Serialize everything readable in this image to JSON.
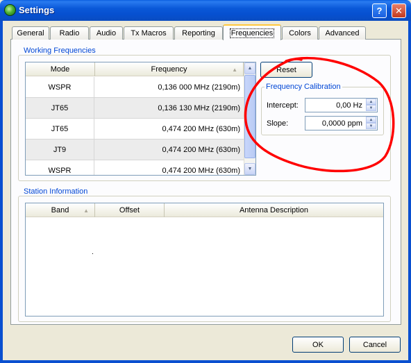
{
  "window": {
    "title": "Settings",
    "help_label": "?",
    "close_label": "✕"
  },
  "tabs": [
    {
      "label": "General"
    },
    {
      "label": "Radio"
    },
    {
      "label": "Audio"
    },
    {
      "label": "Tx Macros"
    },
    {
      "label": "Reporting"
    },
    {
      "label": "Frequencies"
    },
    {
      "label": "Colors"
    },
    {
      "label": "Advanced"
    }
  ],
  "working_frequencies": {
    "title": "Working Frequencies",
    "columns": {
      "mode": "Mode",
      "frequency": "Frequency"
    },
    "rows": [
      {
        "mode": "WSPR",
        "frequency": "0,136 000 MHz (2190m)"
      },
      {
        "mode": "JT65",
        "frequency": "0,136 130 MHz (2190m)"
      },
      {
        "mode": "JT65",
        "frequency": "0,474 200 MHz (630m)"
      },
      {
        "mode": "JT9",
        "frequency": "0,474 200 MHz (630m)"
      },
      {
        "mode": "WSPR",
        "frequency": "0,474 200 MHz (630m)"
      }
    ],
    "reset_label": "Reset"
  },
  "frequency_calibration": {
    "title": "Frequency Calibration",
    "intercept_label": "Intercept:",
    "intercept_value": "0,00 Hz",
    "slope_label": "Slope:",
    "slope_value": "0,0000 ppm"
  },
  "station_information": {
    "title": "Station Information",
    "columns": {
      "band": "Band",
      "offset": "Offset",
      "antenna": "Antenna Description"
    }
  },
  "footer": {
    "ok_label": "OK",
    "cancel_label": "Cancel"
  },
  "annotation_color": "#ff0000"
}
